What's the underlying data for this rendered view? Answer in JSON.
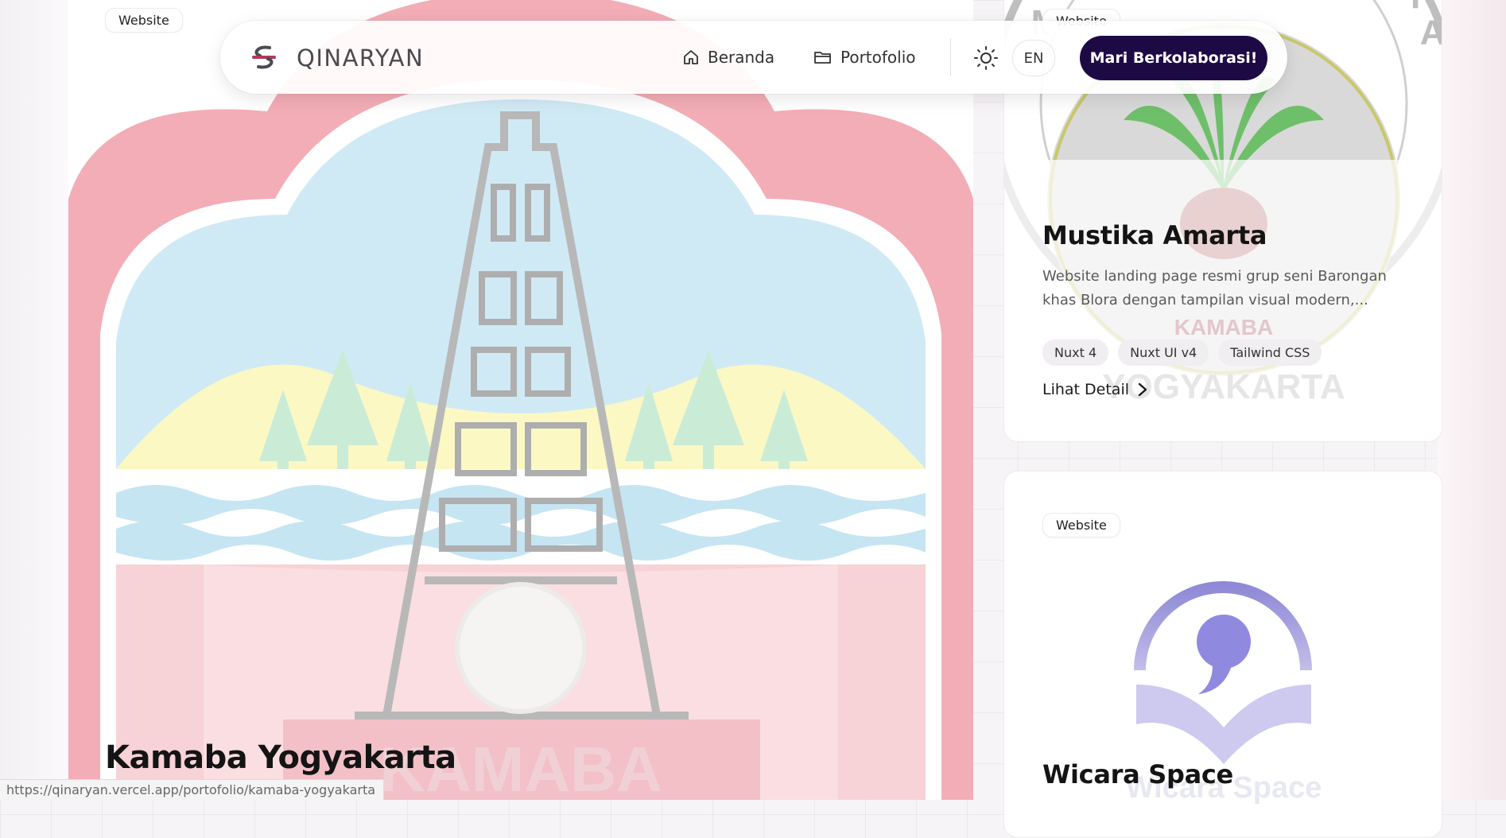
{
  "navbar": {
    "brand": "QINARYAN",
    "items": [
      {
        "label": "Beranda",
        "icon": "home-icon"
      },
      {
        "label": "Portofolio",
        "icon": "folder-icon"
      }
    ],
    "theme_icon": "sun-icon",
    "language": "EN",
    "cta_label": "Mari Berkolaborasi!",
    "cta_color": "#1d0a45"
  },
  "main_card": {
    "badge": "Website",
    "title": "Kamaba Yogyakarta",
    "image_text": "KAMABA"
  },
  "cards": [
    {
      "badge": "Website",
      "title": "Mustika Amarta",
      "description": "Website landing page resmi grup seni Barongan khas Blora dengan tampilan visual modern,...",
      "tags": [
        "Nuxt 4",
        "Nuxt UI v4",
        "Tailwind CSS"
      ],
      "link_label": "Lihat Detail",
      "image_text_top": "MUSTIKA AMARTA",
      "image_text_bottom": "YOGYAKARTA",
      "image_text_mid": "KAMABA"
    },
    {
      "badge": "Website",
      "title": "Wicara Space",
      "image_text": "Wicara Space"
    }
  ],
  "status_url": "https://qinaryan.vercel.app/portofolio/kamaba-yogyakarta"
}
